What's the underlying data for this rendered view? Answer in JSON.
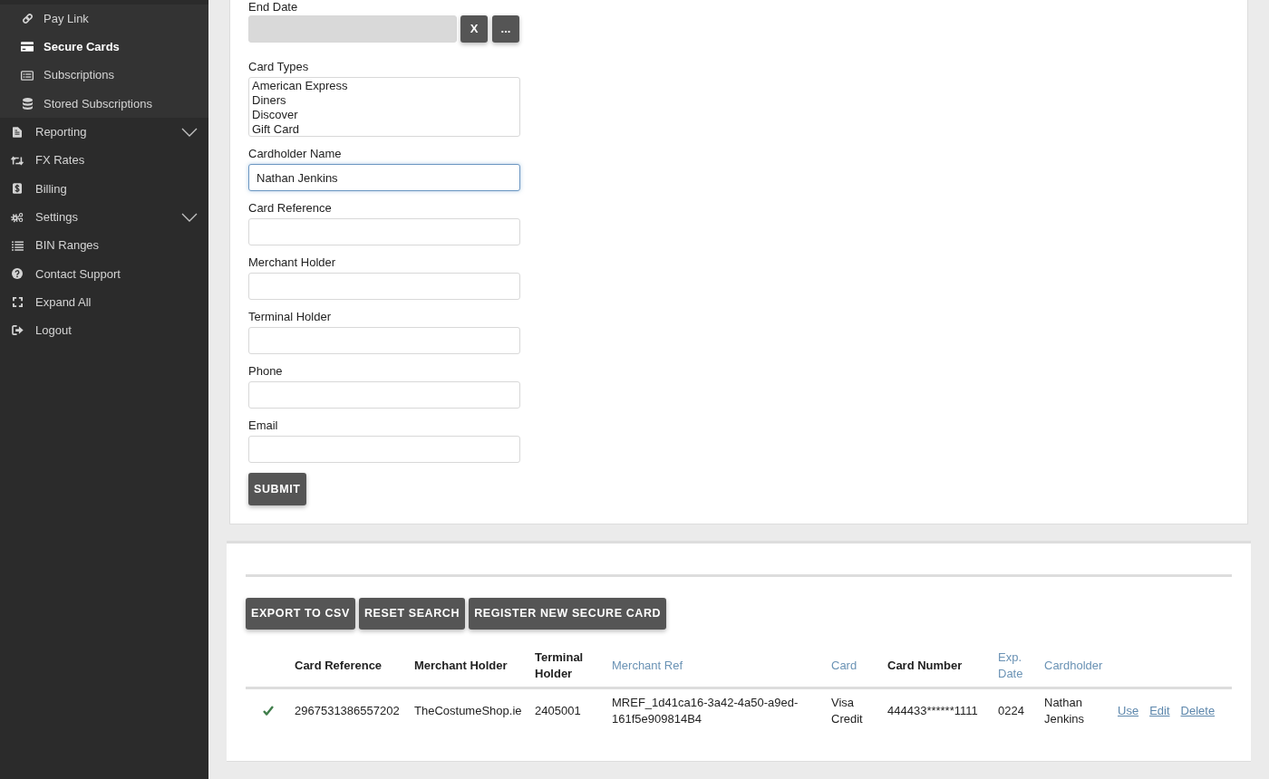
{
  "sidebar": {
    "submenu": [
      {
        "label": "Pay Link",
        "selected": false
      },
      {
        "label": "Secure Cards",
        "selected": true
      },
      {
        "label": "Subscriptions",
        "selected": false
      },
      {
        "label": "Stored Subscriptions",
        "selected": false
      }
    ],
    "items": [
      {
        "label": "Reporting",
        "selected": false,
        "expandable": true
      },
      {
        "label": "FX Rates",
        "selected": false,
        "expandable": false
      },
      {
        "label": "Billing",
        "selected": false,
        "expandable": false
      },
      {
        "label": "Settings",
        "selected": false,
        "expandable": true
      },
      {
        "label": "BIN Ranges",
        "selected": false,
        "expandable": false
      },
      {
        "label": "Contact Support",
        "selected": false,
        "expandable": false
      },
      {
        "label": "Expand All",
        "selected": false,
        "expandable": false
      },
      {
        "label": "Logout",
        "selected": false,
        "expandable": false
      }
    ]
  },
  "search_form": {
    "end_date": {
      "label": "End Date",
      "disabled": true,
      "clear_button": "X",
      "picker_button": "..."
    },
    "card_types": {
      "label": "Card Types",
      "options": [
        {
          "label": "American Express",
          "selected": false
        },
        {
          "label": "Diners",
          "selected": false
        },
        {
          "label": "Discover",
          "selected": false
        },
        {
          "label": "Gift Card",
          "selected": false
        }
      ]
    },
    "fields": [
      {
        "label": "Cardholder Name",
        "value": "Nathan Jenkins",
        "focused": true
      },
      {
        "label": "Card Reference",
        "focused": false
      },
      {
        "label": "Merchant Holder",
        "focused": false
      },
      {
        "label": "Terminal Holder",
        "focused": false
      },
      {
        "label": "Phone",
        "focused": false
      },
      {
        "label": "Email",
        "focused": false
      }
    ],
    "submit_button": "SUBMIT"
  },
  "results": {
    "buttons": [
      "EXPORT TO CSV",
      "RESET SEARCH",
      "REGISTER NEW SECURE CARD"
    ],
    "table": {
      "columns": [
        {
          "label": "Card Reference",
          "sortable": false
        },
        {
          "label": "Merchant Holder",
          "sortable": false
        },
        {
          "label": "Terminal Holder",
          "sortable": false
        },
        {
          "label": "Merchant Ref",
          "sortable": true
        },
        {
          "label": "Card",
          "sortable": true
        },
        {
          "label": "Card Number",
          "sortable": false
        },
        {
          "label": "Exp. Date",
          "sortable": true
        },
        {
          "label": "Cardholder",
          "sortable": true
        }
      ],
      "rows": [
        {
          "active": true,
          "cells": [
            "2967531386557202",
            "TheCostumeShop.ie",
            "2405001",
            "MREF_1d41ca16-3a42-4a50-a9ed-161f5e909814B4",
            "Visa Credit",
            "444433******1111",
            "0224",
            "Nathan Jenkins"
          ],
          "actions": [
            "Use",
            "Edit",
            "Delete"
          ]
        }
      ]
    }
  }
}
